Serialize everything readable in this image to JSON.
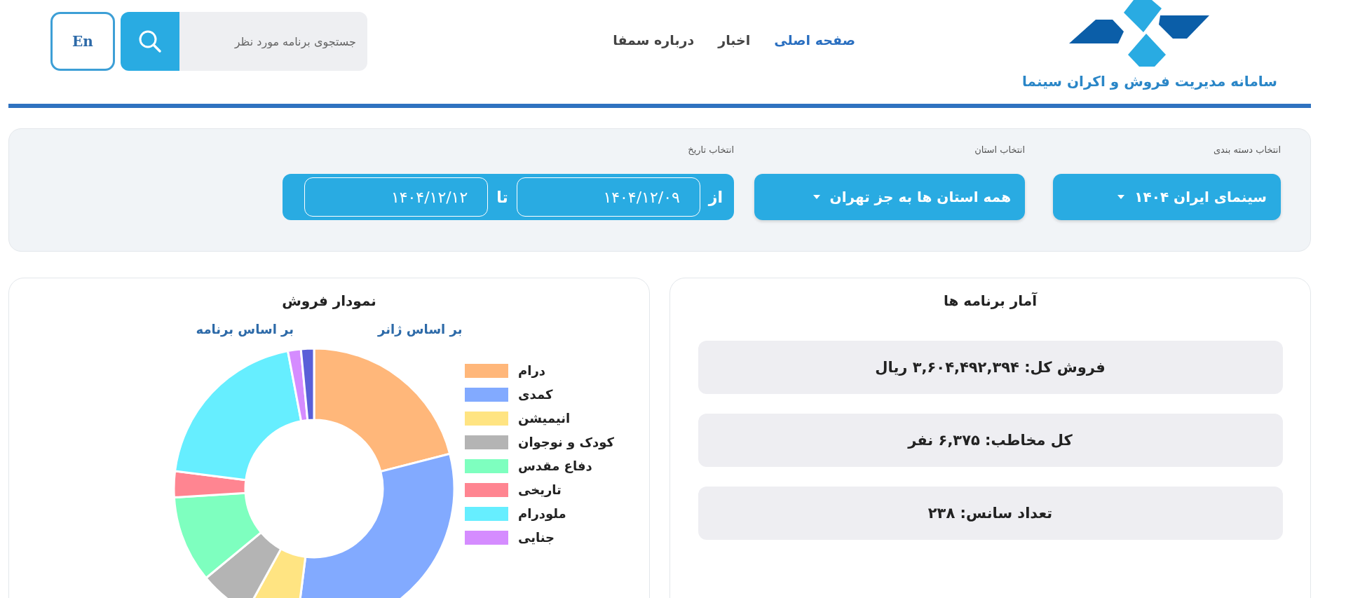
{
  "header": {
    "logo_caption": "سامانه مدیریت فروش و اکران سینما",
    "nav": [
      {
        "label": "صفحه اصلی",
        "selected": true
      },
      {
        "label": "اخبار",
        "selected": false
      },
      {
        "label": "درباره سمفا",
        "selected": false
      }
    ],
    "search": {
      "placeholder": "جستجوی برنامه مورد نظر"
    },
    "language_button": "En"
  },
  "filters": {
    "category": {
      "label": "انتخاب دسته بندی",
      "value": "سینمای ایران ۱۴۰۴"
    },
    "province": {
      "label": "انتخاب استان",
      "value": "همه استان ها به جز تهران"
    },
    "date": {
      "label": "انتخاب تاریخ",
      "from_label": "از",
      "from": "۱۴۰۴/۱۲/۰۹",
      "to_label": "تا",
      "to": "۱۴۰۴/۱۲/۱۲"
    }
  },
  "stats": {
    "title": "آمار برنامه ها",
    "items": [
      "فروش کل: ۳,۶۰۴,۴۹۲,۳۹۴ ریال",
      "کل مخاطب: ۶,۳۷۵ نفر",
      "تعداد سانس: ۲۳۸"
    ]
  },
  "sales_chart": {
    "title": "نمودار فروش",
    "links": [
      "بر اساس ژانر",
      "بر اساس برنامه"
    ],
    "legend": [
      {
        "label": "درام",
        "color": "#ffb77a"
      },
      {
        "label": "کمدی",
        "color": "#82aaff"
      },
      {
        "label": "انیمیشن",
        "color": "#ffe482"
      },
      {
        "label": "کودک و نوجوان",
        "color": "#b4b4b4"
      },
      {
        "label": "دفاع مقدس",
        "color": "#7effbf"
      },
      {
        "label": "تاریخی",
        "color": "#ff8591"
      },
      {
        "label": "ملودرام",
        "color": "#66eeff"
      },
      {
        "label": "جنایی",
        "color": "#d58cff"
      }
    ]
  }
}
